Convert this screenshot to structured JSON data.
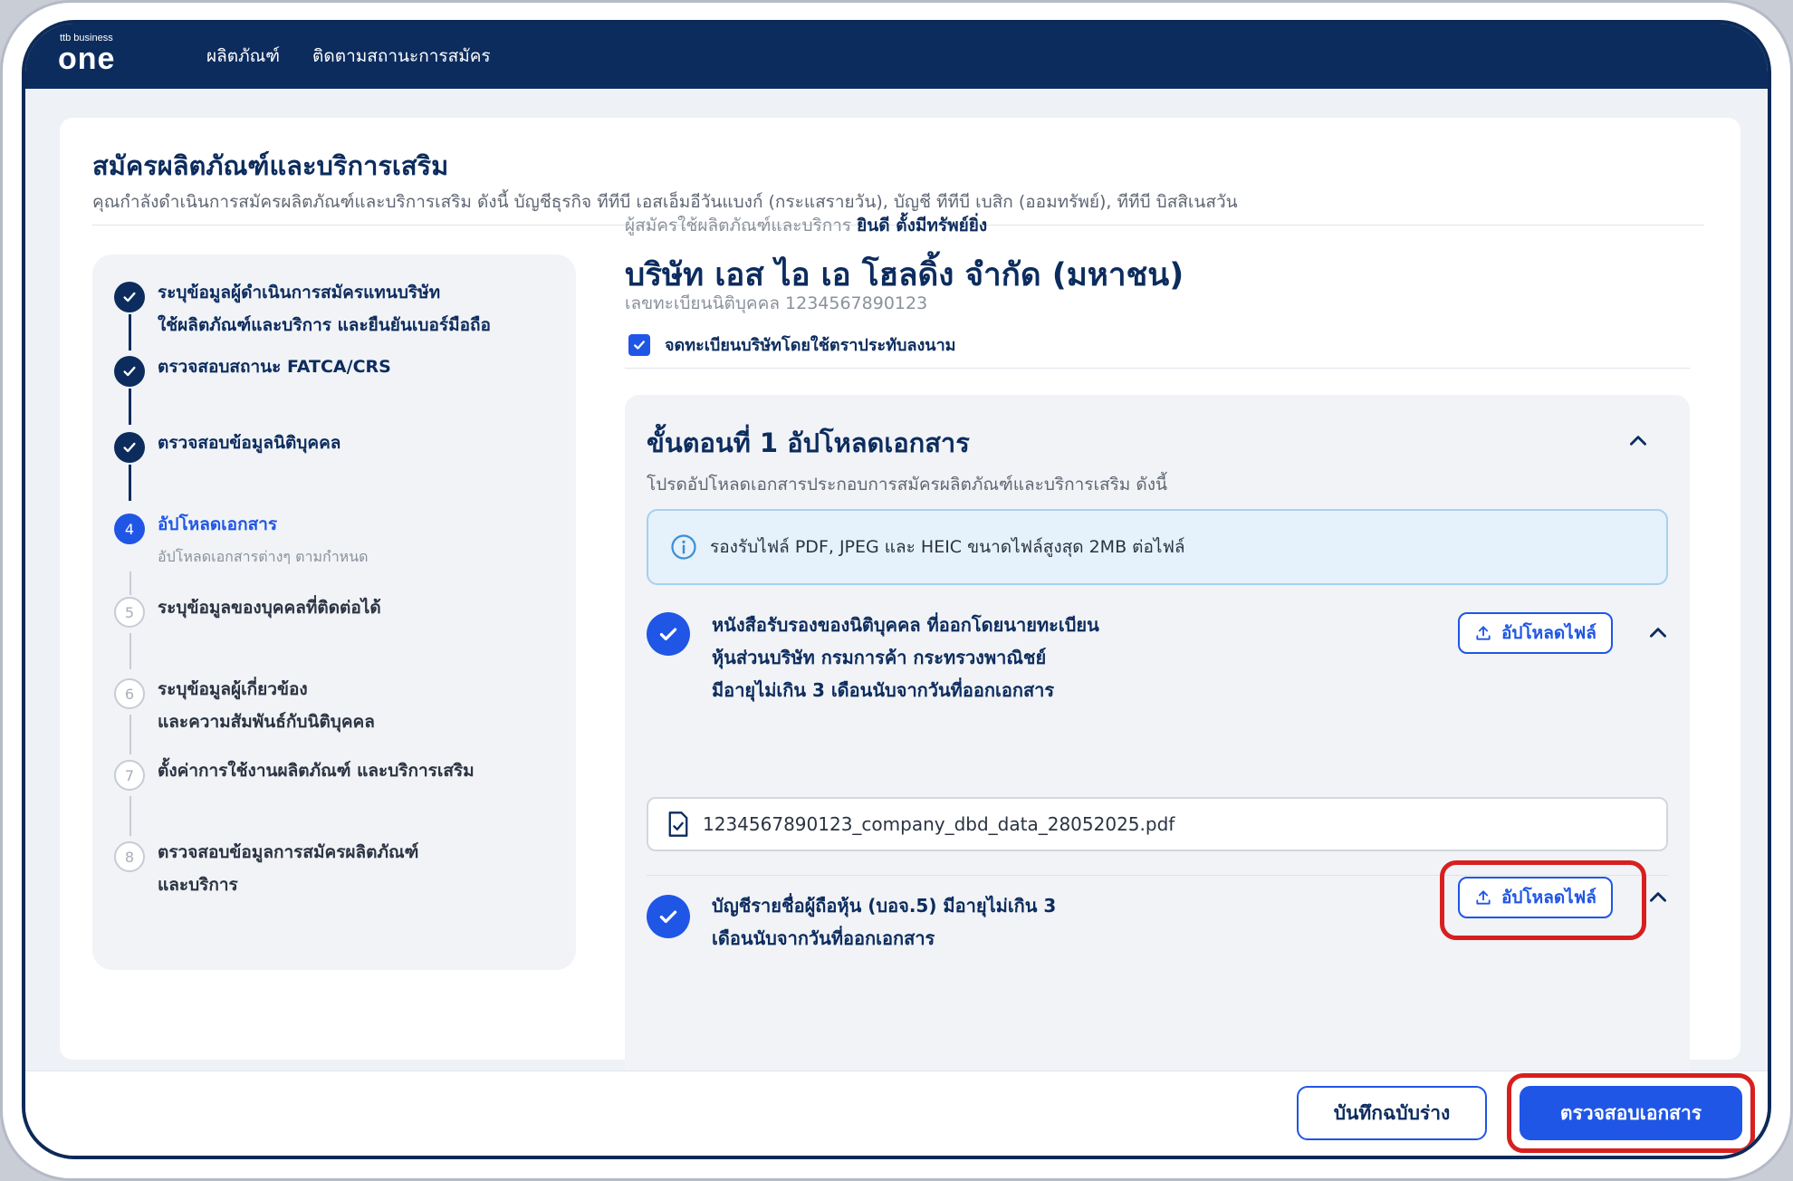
{
  "brand": {
    "small": "ttb business",
    "big": "one"
  },
  "nav": {
    "items": [
      {
        "label": "ผลิตภัณฑ์"
      },
      {
        "label": "ติดตามสถานะการสมัคร"
      }
    ]
  },
  "header": {
    "title": "สมัครผลิตภัณฑ์และบริการเสริม",
    "subtitle": "คุณกำลังดำเนินการสมัครผลิตภัณฑ์และบริการเสริม ดังนี้  บัญชีธุรกิจ ทีทีบี เอสเอ็มอีวันแบงก์ (กระแสรายวัน),  บัญชี ทีทีบี เบสิก (ออมทรัพย์),  ทีทีบี บิสสิเนสวัน"
  },
  "steps": [
    {
      "number": "1",
      "state": "done",
      "line1": "ระบุข้อมูลผู้ดำเนินการสมัครแทนบริษัท",
      "line2": "ใช้ผลิตภัณฑ์และบริการ และยืนยันเบอร์มือถือ"
    },
    {
      "number": "2",
      "state": "done",
      "line1": "ตรวจสอบสถานะ FATCA/CRS"
    },
    {
      "number": "3",
      "state": "done",
      "line1": "ตรวจสอบข้อมูลนิติบุคคล"
    },
    {
      "number": "4",
      "state": "active",
      "line1": "อัปโหลดเอกสาร",
      "sub": "อัปโหลดเอกสารต่างๆ ตามกำหนด"
    },
    {
      "number": "5",
      "state": "todo",
      "line1": "ระบุข้อมูลของบุคคลที่ติดต่อได้"
    },
    {
      "number": "6",
      "state": "todo",
      "line1": "ระบุข้อมูลผู้เกี่ยวข้อง",
      "line2": "และความสัมพันธ์กับนิติบุคคล"
    },
    {
      "number": "7",
      "state": "todo",
      "line1": "ตั้งค่าการใช้งานผลิตภัณฑ์ และบริการเสริม"
    },
    {
      "number": "8",
      "state": "todo",
      "line1": "ตรวจสอบข้อมูลการสมัครผลิตภัณฑ์",
      "line2": "และบริการ"
    }
  ],
  "applicant": {
    "label": "ผู้สมัครใช้ผลิตภัณฑ์และบริการ",
    "name": "ยินดี ตั้งมีทรัพย์ยิ่ง"
  },
  "company": {
    "name": "บริษัท เอส ไอ เอ โฮลดิ้ง จำกัด (มหาชน)",
    "reg_no": "เลขทะเบียนนิติบุคคล 1234567890123"
  },
  "seal_checkbox": {
    "label": "จดทะเบียนบริษัทโดยใช้ตราประทับลงนาม",
    "checked": true
  },
  "upload_section": {
    "title": "ขั้นตอนที่ 1 อัปโหลดเอกสาร",
    "subtitle": "โปรดอัปโหลดเอกสารประกอบการสมัครผลิตภัณฑ์และบริการเสริม ดังนี้",
    "info": "รองรับไฟล์ PDF, JPEG และ HEIC ขนาดไฟล์สูงสุด 2MB ต่อไฟล์",
    "documents": [
      {
        "line1": "หนังสือรับรองของนิติบุคคล ที่ออกโดยนายทะเบียน",
        "line2": "หุ้นส่วนบริษัท กรมการค้า กระทรวงพาณิชย์",
        "line3": "มีอายุไม่เกิน 3 เดือนนับจากวันที่ออกเอกสาร",
        "upload_label": "อัปโหลดไฟล์",
        "file": "1234567890123_company_dbd_data_28052025.pdf"
      },
      {
        "line1": "บัญชีรายชื่อผู้ถือหุ้น (บอจ.5) มีอายุไม่เกิน 3",
        "line2": "เดือนนับจากวันที่ออกเอกสาร",
        "upload_label": "อัปโหลดไฟล์"
      }
    ]
  },
  "footer": {
    "draft_label": "บันทึกฉบับร่าง",
    "check_label": "ตรวจสอบเอกสาร"
  },
  "colors": {
    "navy": "#0c2c5e",
    "primary": "#1f56e6",
    "highlight": "#d81f1f"
  }
}
